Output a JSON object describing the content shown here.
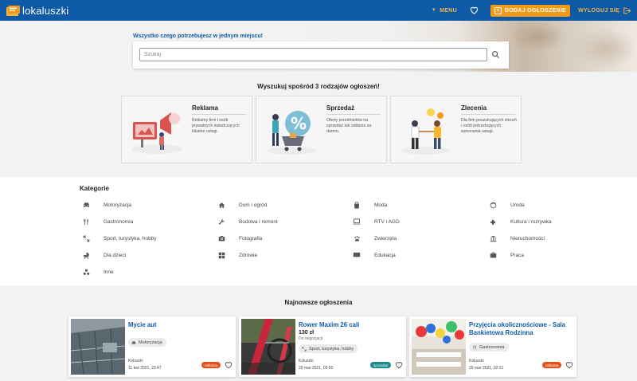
{
  "header": {
    "logo_text": "lokaluszki",
    "menu_label": "MENU",
    "add_label": "DODAJ OGŁOSZENIE",
    "logout_label": "WYLOGUJ SIĘ",
    "colors": {
      "bar": "#0e5aa7",
      "accent": "#f39a16"
    }
  },
  "hero": {
    "tagline": "Wszystko czego potrzebujesz w jednym miejscu!",
    "search_placeholder": "Szukaj"
  },
  "types": {
    "title": "Wyszukuj spośród 3 rodzajów ogłoszeń!",
    "items": [
      {
        "name": "Reklama",
        "desc": "Reklamy firm i osób prywatnych świadczących lokalne usługi."
      },
      {
        "name": "Sprzedaż",
        "desc": "Oferty przedmiotów na sprzedaż lub oddania za darmo."
      },
      {
        "name": "Zlecenia",
        "desc": "Dla firm poszukujących zleceń i osób potrzebujących wykonania usługi."
      }
    ]
  },
  "categories": {
    "title": "Kategorie",
    "items": [
      {
        "label": "Motoryzacja",
        "icon": "car-icon"
      },
      {
        "label": "Dom i ogród",
        "icon": "home-icon"
      },
      {
        "label": "Moda",
        "icon": "bag-icon"
      },
      {
        "label": "Uroda",
        "icon": "face-icon"
      },
      {
        "label": "Gastronomia",
        "icon": "cutlery-icon"
      },
      {
        "label": "Budowa i remont",
        "icon": "wrench-icon"
      },
      {
        "label": "RTV i AGD",
        "icon": "laptop-icon"
      },
      {
        "label": "Kultura i rozrywka",
        "icon": "puzzle-icon"
      },
      {
        "label": "Sport, turystyka, hobby",
        "icon": "arrows-icon"
      },
      {
        "label": "Fotografia",
        "icon": "camera-icon"
      },
      {
        "label": "Zwierzęta",
        "icon": "paw-icon"
      },
      {
        "label": "Nieruchomości",
        "icon": "bank-icon"
      },
      {
        "label": "Dla dzieci",
        "icon": "stroller-icon"
      },
      {
        "label": "Zdrowie",
        "icon": "health-icon"
      },
      {
        "label": "Edukacja",
        "icon": "book-icon"
      },
      {
        "label": "Praca",
        "icon": "briefcase-icon"
      },
      {
        "label": "Inne",
        "icon": "dots-icon"
      }
    ]
  },
  "latest": {
    "title": "Najnowsze ogłoszenia",
    "ads": [
      {
        "title": "Mycie aut",
        "price": "",
        "nego": "",
        "category": "Motoryzacja",
        "city": "Koluszki",
        "date": "11 kwi 2021, 23:47",
        "badge": "reklama",
        "badge_color": "#e0541b"
      },
      {
        "title": "Rower Maxim 26 cali",
        "price": "130 zł",
        "nego": "Do negocjacji",
        "category": "Sport, turystyka, hobby",
        "city": "Koluszki",
        "date": "29 mar 2021, 03:50",
        "badge": "sprzedaż",
        "badge_color": "#1b8a8a"
      },
      {
        "title": "Przyjęcia okolicznościowe - Sala Bankietowa Rodzinna",
        "price": "",
        "nego": "",
        "category": "Gastronomia",
        "city": "Koluszki",
        "date": "29 mar 2021, 02:31",
        "badge": "reklama",
        "badge_color": "#e0541b"
      }
    ]
  }
}
